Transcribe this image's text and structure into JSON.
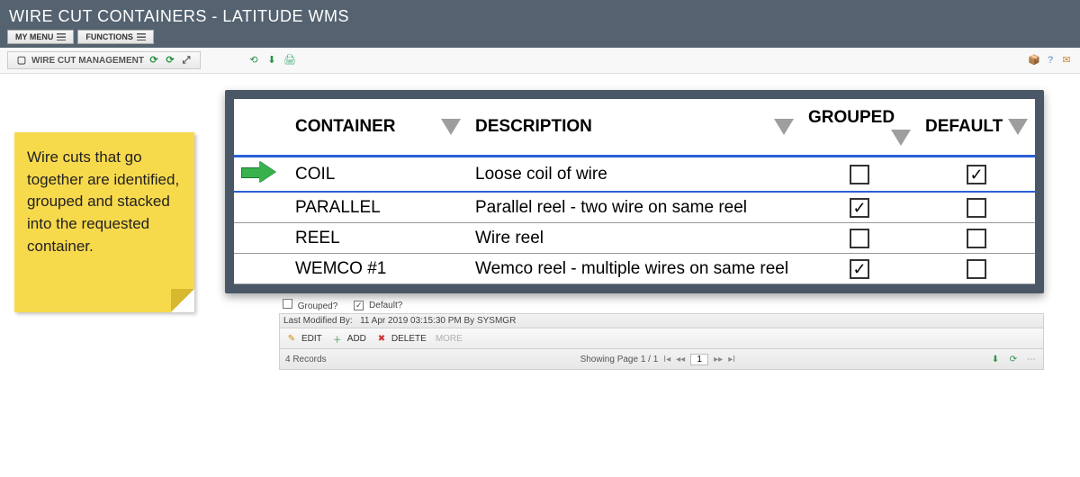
{
  "header": {
    "title": "WIRE CUT CONTAINERS - LATITUDE WMS"
  },
  "menu": {
    "my_menu": "MY MENU",
    "functions": "FUNCTIONS"
  },
  "panel": {
    "name": "WIRE CUT MANAGEMENT"
  },
  "note": {
    "text": "Wire cuts that go together are identified, grouped and stacked into the requested container."
  },
  "columns": {
    "container": "CONTAINER",
    "description": "DESCRIPTION",
    "grouped": "GROUPED",
    "default": "DEFAULT"
  },
  "rows": [
    {
      "container": "COIL",
      "description": "Loose coil of wire",
      "grouped": false,
      "default": true,
      "selected": true
    },
    {
      "container": "PARALLEL",
      "description": "Parallel reel - two wire on same reel",
      "grouped": true,
      "default": false,
      "selected": false
    },
    {
      "container": "REEL",
      "description": "Wire reel",
      "grouped": false,
      "default": false,
      "selected": false
    },
    {
      "container": "WEMCO #1",
      "description": "Wemco reel - multiple wires on same reel",
      "grouped": true,
      "default": false,
      "selected": false
    }
  ],
  "meta": {
    "grouped_label": "Grouped?",
    "grouped_checked": false,
    "default_label": "Default?",
    "default_checked": true,
    "lastmod_label": "Last Modified By:",
    "lastmod_value": "11 Apr 2019 03:15:30 PM By SYSMGR"
  },
  "actions": {
    "edit": "EDIT",
    "add": "ADD",
    "delete": "DELETE",
    "more": "MORE"
  },
  "footer": {
    "records_label": "4 Records",
    "pager_label": "Showing Page 1 / 1",
    "page_value": "1"
  }
}
